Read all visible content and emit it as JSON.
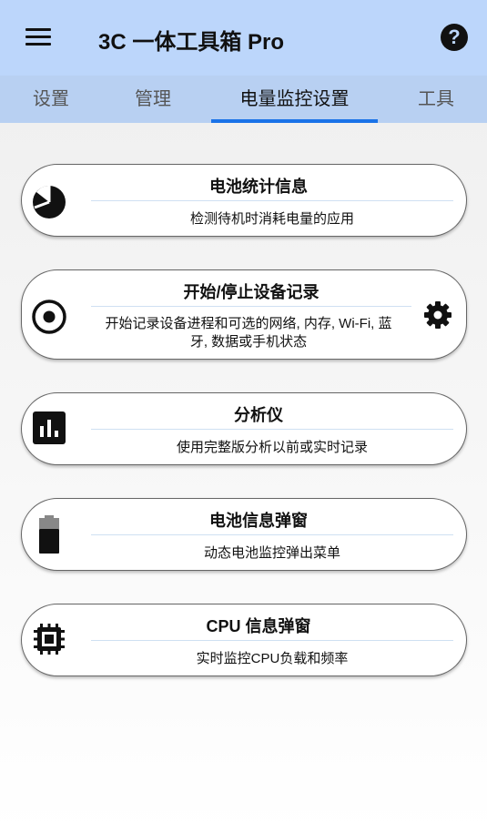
{
  "app": {
    "title": "3C 一体工具箱 Pro",
    "accent_color": "#1a73e8",
    "appbar_color": "#bcd6fb"
  },
  "toolbar": {
    "menu_icon": "hamburger-menu-icon",
    "help_icon": "help-circle-icon",
    "help_glyph": "?"
  },
  "tabs": [
    {
      "label": "设置",
      "active": false
    },
    {
      "label": "管理",
      "active": false
    },
    {
      "label": "电量监控设置",
      "active": true
    },
    {
      "label": "工具",
      "active": false
    }
  ],
  "cards": [
    {
      "title": "电池统计信息",
      "desc": "检测待机时消耗电量的应用",
      "icon": "pie-chart-icon"
    },
    {
      "title": "开始/停止设备记录",
      "desc_line1": "开始记录设备进程和可选的网络, 内存, Wi-Fi, 蓝",
      "desc_line2": "牙, 数据或手机状态",
      "icon": "record-icon",
      "side_icon": "gear-icon"
    },
    {
      "title": "分析仪",
      "desc": "使用完整版分析以前或实时记录",
      "icon": "bar-chart-icon"
    },
    {
      "title": "电池信息弹窗",
      "desc": "动态电池监控弹出菜单",
      "icon": "battery-icon"
    },
    {
      "title": "CPU 信息弹窗",
      "desc": "实时监控CPU负载和频率",
      "icon": "cpu-chip-icon"
    }
  ]
}
